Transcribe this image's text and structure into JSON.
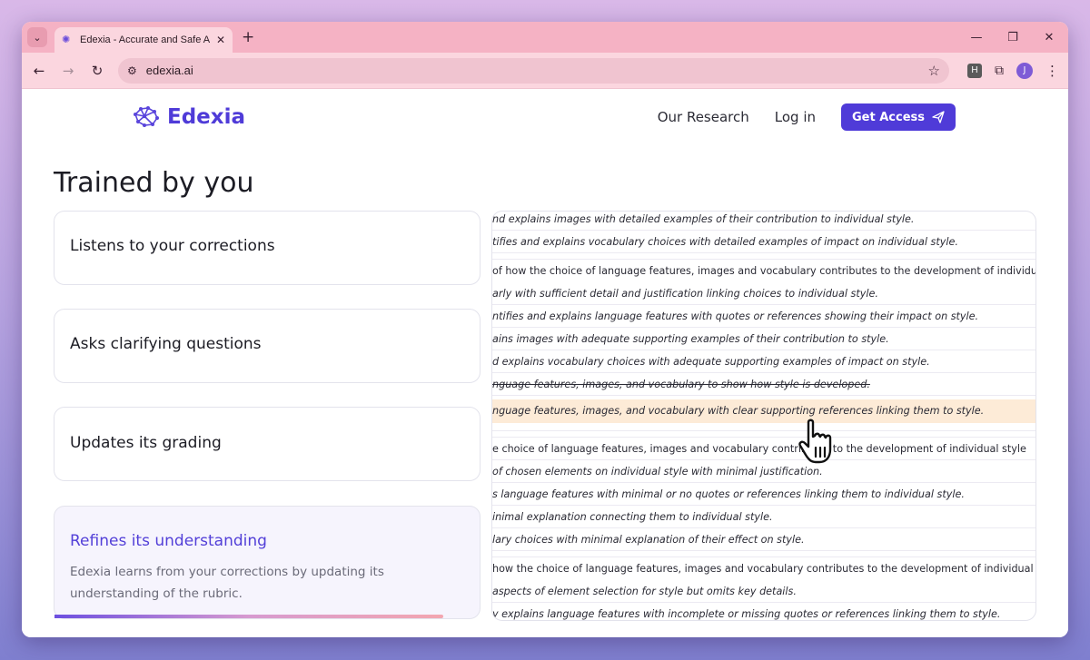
{
  "browser": {
    "tab_title": "Edexia - Accurate and Safe AI E",
    "url": "edexia.ai",
    "extension_label": "H",
    "profile_initial": "J",
    "icons": [
      "chevron-down-icon",
      "close-icon",
      "plus-icon",
      "minimize-icon",
      "restore-icon",
      "back-icon",
      "forward-icon",
      "reload-icon",
      "site-settings-icon",
      "star-icon",
      "puzzle-icon",
      "kebab-menu-icon"
    ]
  },
  "header": {
    "logo_text": "Edexia",
    "nav": {
      "research": "Our Research",
      "login": "Log in",
      "cta": "Get Access"
    }
  },
  "main": {
    "heading": "Trained by you",
    "features": [
      {
        "title": "Listens to your corrections"
      },
      {
        "title": "Asks clarifying questions"
      },
      {
        "title": "Updates its grading"
      },
      {
        "title": "Refines its understanding",
        "description": "Edexia learns from your corrections by updating its understanding of the rubric.",
        "progress": 0.91
      }
    ],
    "rubric_lines": [
      "nd explains images with detailed examples of their contribution to individual style.",
      "tifies and explains vocabulary choices with detailed examples of impact on individual style.",
      "of how the choice of language features, images and vocabulary contributes to the development of individual style",
      "arly with sufficient detail and justification linking choices to individual style.",
      "ntifies and explains language features with quotes or references showing their impact on style.",
      "ains images with adequate supporting examples of their contribution to style.",
      "d explains vocabulary choices with adequate supporting examples of impact on style.",
      "nguage features, images, and vocabulary to show how style is developed.",
      "nguage features, images, and vocabulary with clear supporting references linking them to style.",
      "e choice of language features, images and vocabulary contributes to the development of individual style",
      "of chosen elements on individual style with minimal justification.",
      "s language features with minimal or no quotes or references linking them to individual style.",
      "inimal explanation connecting them to individual style.",
      "lary choices with minimal explanation of their effect on style.",
      "how the choice of language features, images and vocabulary contributes to the development of individual style",
      "aspects of element selection for style but omits key details.",
      "y explains language features with incomplete or missing quotes or references linking them to style."
    ],
    "highlight_color": "#fdebd7",
    "accent_color": "#4f3bd8"
  }
}
